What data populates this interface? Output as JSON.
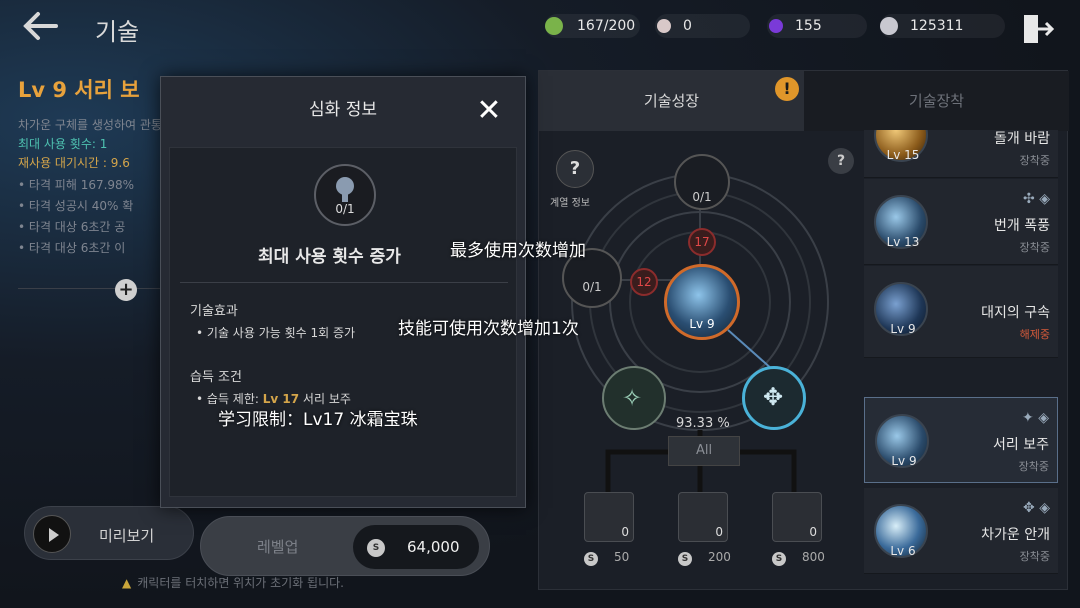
{
  "header": {
    "back_icon": "back-arrow-icon",
    "title": "기술",
    "resources": [
      {
        "icon": "stamina-icon",
        "value": "167/200",
        "color": "#7ab34a"
      },
      {
        "icon": "pearl-icon",
        "value": "0",
        "color": "#d8c8c8"
      },
      {
        "icon": "crystal-icon",
        "value": "155",
        "color": "#7a3ad8"
      },
      {
        "icon": "silver-coin-icon",
        "value": "125311",
        "color": "#c8c8d0"
      }
    ],
    "exit_icon": "exit-door-icon"
  },
  "left": {
    "skill_title": "Lv 9 서리 보",
    "desc": "차가운 구체를 생성하여 관통합니다",
    "max_uses": "최대 사용 횟수: 1",
    "cooldown": "재사용 대기시간 : 9.6",
    "bullets": [
      "타격 피해 167.98%",
      "타격 성공시 40% 확",
      "타격 대상 6초간 공",
      "타격 대상 6초간 이"
    ],
    "preview_label": "미리보기",
    "warning": "캐릭터를 터치하면 위치가 초기화 됩니다."
  },
  "modal": {
    "title": "심화 정보",
    "node_count": "0/1",
    "node_name": "최대 사용 횟수 증가",
    "annotation_name": "最多使用次数增加",
    "effect_title": "기술효과",
    "effect_line": "기술 사용 가능 횟수 1회 증가",
    "annotation_effect": "技能可使用次数增加1次",
    "req_title": "습득 조건",
    "req_line_prefix": "습득 제한: ",
    "req_line_level": "Lv 17",
    "req_line_suffix": " 서리 보주",
    "annotation_req": "学习限制：Lv17 冰霜宝珠"
  },
  "levelup": {
    "label": "레벨업",
    "price": "64,000"
  },
  "tabs": {
    "growth": "기술성장",
    "equip": "기술장착",
    "alert": "!"
  },
  "tree": {
    "lineage_label": "계열 정보",
    "help": "?",
    "top_node": "0/1",
    "left_node": "0/1",
    "top_req": "17",
    "left_req": "12",
    "center_level": "Lv 9",
    "percent": "93.33 %",
    "all_label": "All",
    "books": [
      {
        "count": "0",
        "cost": "50"
      },
      {
        "count": "0",
        "cost": "200"
      },
      {
        "count": "0",
        "cost": "800"
      }
    ]
  },
  "skills": [
    {
      "level": "Lv 15",
      "name": "돌개 바람",
      "status": "장착중",
      "color": "#c8902a"
    },
    {
      "level": "Lv 13",
      "name": "번개 폭풍",
      "status": "장착중",
      "color": "#5a8ad8"
    },
    {
      "level": "Lv 9",
      "name": "대지의 구속",
      "status": "해제중",
      "color": "#4a6a9a"
    },
    {
      "level": "Lv 9",
      "name": "서리 보주",
      "status": "장착중",
      "color": "#7ab8e8"
    },
    {
      "level": "Lv 6",
      "name": "차가운 안개",
      "status": "장착중",
      "color": "#6aa8d8"
    }
  ]
}
